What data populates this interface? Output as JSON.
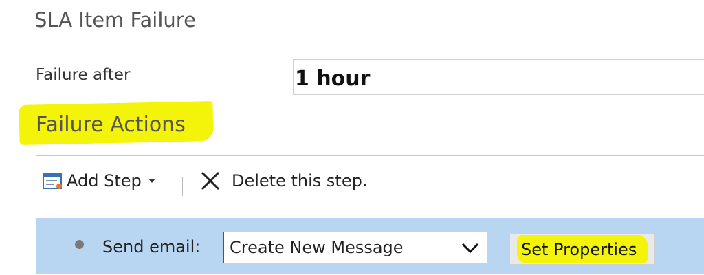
{
  "section": {
    "title": "SLA Item Failure"
  },
  "failure_after": {
    "label": "Failure after",
    "value": "1 hour"
  },
  "failure_actions": {
    "title": "Failure Actions",
    "toolbar": {
      "add_step_label": "Add Step",
      "delete_step_label": "Delete this step."
    },
    "step": {
      "label": "Send email:",
      "selected_option": "Create New Message",
      "set_properties_label": "Set Properties"
    }
  },
  "colors": {
    "highlight": "#f4f40a",
    "step_row_background": "#b8d6f2",
    "title_text": "#555555"
  },
  "icons": {
    "add_step": "add-step-icon",
    "dropdown_caret": "caret-down-icon",
    "delete": "close-x-icon",
    "select_chevron": "chevron-down-icon",
    "bullet": "bullet-dot-icon"
  }
}
